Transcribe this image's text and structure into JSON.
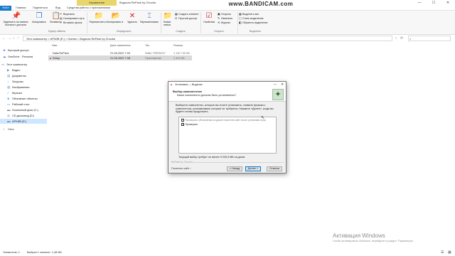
{
  "window": {
    "title": "Bugsnax-RePack by Chovka",
    "manage_tab": "Управление",
    "controls": [
      "—",
      "☐",
      "✕"
    ]
  },
  "watermark": {
    "title": "www.BANDICAM.com",
    "subtitle": ""
  },
  "ribbon_tabs": [
    "Файл",
    "Главная",
    "Поделиться",
    "Вид",
    "Средства работы с приложениями"
  ],
  "ribbon": {
    "pin_label": "Закрепить на панели быстрого доступа",
    "copy_label": "Копировать",
    "paste_label": "Вставить",
    "cut_label": "Вырезать",
    "copy_path_label": "Скопировать путь",
    "paste_shortcut_label": "Вставить ярлык",
    "move_label": "Переместить в",
    "copyto_label": "Копировать в",
    "delete_label": "Удалить",
    "rename_label": "Переименовать",
    "new_folder_label": "Новая папка",
    "new_item_label": "Создать элемент",
    "easy_access_label": "Простой доступ",
    "properties_label": "Свойства",
    "open_label": "Открыть",
    "change_label": "Изменить",
    "history_label": "Журнал",
    "select_all_label": "Выделить все",
    "select_none_label": "Снять выделение",
    "invert_label": "Обратить выделение",
    "groups": [
      "Буфер обмена",
      "Упорядочить",
      "Создать",
      "Открыть",
      "Выделить"
    ]
  },
  "address": {
    "path": "Этот компьютер  >  АРХИВ (E:)  >  Games  >  Bugsnax-RePack by Chovka",
    "search_placeholder": ""
  },
  "columns": {
    "name": "Имя",
    "date": "Дата изменения",
    "type": "Тип",
    "size": "Размер"
  },
  "files": [
    {
      "name": "Data.RePack",
      "date": "21.06.2022 7:03",
      "type": "Файл \"REPACK\"",
      "size": "1 110 740 КБ",
      "selected": false,
      "icon": "file-icon"
    },
    {
      "name": "Setup",
      "date": "21.06.2022 7:08",
      "type": "Приложение",
      "size": "1 410 КБ",
      "selected": true,
      "icon": "setup-app-icon"
    }
  ],
  "nav": [
    {
      "label": "Быстрый доступ",
      "icon": "star-icon",
      "color": "#2b78d4",
      "selected": false
    },
    {
      "label": "OneDrive - Personal",
      "icon": "cloud-icon",
      "color": "#2b78d4",
      "selected": false
    },
    {
      "label": "Этот компьютер",
      "icon": "computer-icon",
      "color": "#3a7fd1",
      "selected": false
    },
    {
      "label": "Видео",
      "icon": "video-icon",
      "color": "#6b8fb8",
      "selected": false
    },
    {
      "label": "Документы",
      "icon": "documents-icon",
      "color": "#6b8fb8",
      "selected": false
    },
    {
      "label": "Загрузки",
      "icon": "downloads-icon",
      "color": "#2b78d4",
      "selected": false
    },
    {
      "label": "Изображения",
      "icon": "pictures-icon",
      "color": "#6b8fb8",
      "selected": false
    },
    {
      "label": "Музыка",
      "icon": "music-icon",
      "color": "#2b78d4",
      "selected": false
    },
    {
      "label": "Объемные объекты",
      "icon": "3d-objects-icon",
      "color": "#5a9fd4",
      "selected": false
    },
    {
      "label": "Рабочий стол",
      "icon": "desktop-icon",
      "color": "#3a8fd9",
      "selected": false
    },
    {
      "label": "Локальный диск (C:)",
      "icon": "drive-icon",
      "color": "#777777",
      "selected": false
    },
    {
      "label": "CD-дисковод (D:)",
      "icon": "cd-drive-icon",
      "color": "#777777",
      "selected": false
    },
    {
      "label": "АРХИВ (E:)",
      "icon": "drive-icon",
      "color": "#777777",
      "selected": true
    },
    {
      "label": "Сеть",
      "icon": "network-icon",
      "color": "#3a7fd1",
      "selected": false
    }
  ],
  "status": {
    "items_count": "Элементов: 2",
    "selected": "Выбран 1 элемент: 1,38 МБ"
  },
  "activation": {
    "title": "Активация Windows",
    "subtitle": "Чтобы активировать Windows, перейдите в раздел \"Параметры\"."
  },
  "dialog": {
    "title": "Установка — Bugsnax",
    "header_title": "Выбор компонентов",
    "header_subtitle": "Какие компоненты должны быть установлены?",
    "description": "Выберите компоненты, которые вы хотите установить; снимите флажки с компонентов, устанавливать которые не требуется. Нажмите «Далее», когда вы будете готовы продолжить.",
    "options": [
      {
        "label": "Проверить обновления на диске носителя сайт после установки игры",
        "checked": false
      },
      {
        "label": "Проверить",
        "checked": true
      }
    ],
    "space_note": "Текущий выбор требует не менее 9 025,9 МБ на диске.",
    "brand": "RePack by Chovka",
    "site_link": "Посетить сайт",
    "back_label": "< Назад",
    "next_label": "Далее >",
    "cancel_label": "Отмена"
  }
}
